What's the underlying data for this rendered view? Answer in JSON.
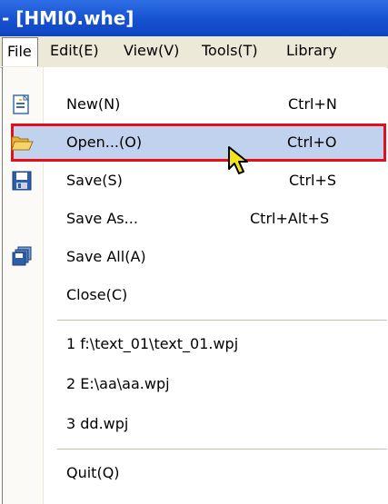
{
  "window": {
    "title": "- [HMI0.whe]"
  },
  "menubar": {
    "file": "File",
    "edit": "Edit(E)",
    "view": "View(V)",
    "tools": "Tools(T)",
    "library": "Library"
  },
  "file_menu": {
    "new": {
      "label": "New(N)",
      "shortcut": "Ctrl+N",
      "icon": "new-file-icon"
    },
    "open": {
      "label": "Open...(O)",
      "shortcut": "Ctrl+O",
      "icon": "open-folder-icon"
    },
    "save": {
      "label": "Save(S)",
      "shortcut": "Ctrl+S",
      "icon": "save-disk-icon"
    },
    "save_as": {
      "label": "Save As...",
      "shortcut": "Ctrl+Alt+S"
    },
    "save_all": {
      "label": "Save All(A)",
      "icon": "save-all-icon"
    },
    "close": {
      "label": "Close(C)"
    },
    "recent": [
      "1 f:\\text_01\\text_01.wpj",
      "2 E:\\aa\\aa.wpj",
      "3 dd.wpj"
    ],
    "quit": {
      "label": "Quit(Q)"
    }
  },
  "colors": {
    "titlebar": "#1651cf",
    "menubar": "#ece9d8",
    "highlight_fill": "#c1d2ee",
    "highlight_border": "#e3101b"
  }
}
